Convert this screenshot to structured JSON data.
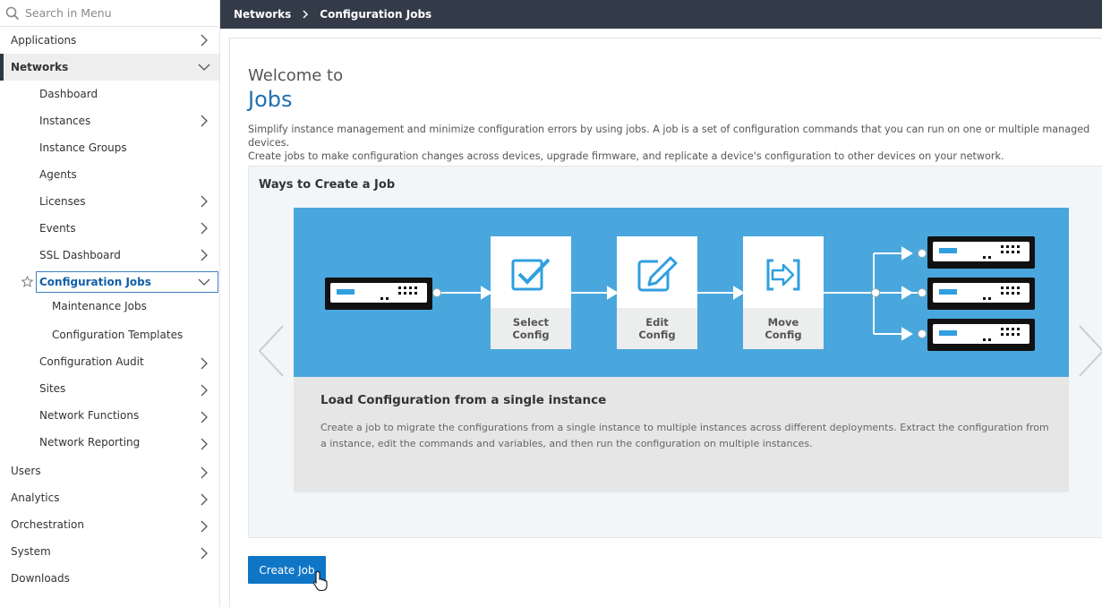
{
  "search": {
    "placeholder": "Search in Menu"
  },
  "sidebar": {
    "applications": "Applications",
    "networks": "Networks",
    "dashboard": "Dashboard",
    "instances": "Instances",
    "instance_groups": "Instance Groups",
    "agents": "Agents",
    "licenses": "Licenses",
    "events": "Events",
    "ssl_dashboard": "SSL Dashboard",
    "configuration_jobs": "Configuration Jobs",
    "maintenance_jobs": "Maintenance Jobs",
    "configuration_templates": "Configuration Templates",
    "configuration_audit": "Configuration Audit",
    "sites": "Sites",
    "network_functions": "Network Functions",
    "network_reporting": "Network Reporting",
    "users": "Users",
    "analytics": "Analytics",
    "orchestration": "Orchestration",
    "system": "System",
    "downloads": "Downloads"
  },
  "breadcrumb": {
    "root": "Networks",
    "current": "Configuration Jobs"
  },
  "main": {
    "welcome": "Welcome to",
    "title": "Jobs",
    "description_line1": "Simplify instance management and minimize configuration errors by using jobs. A job is a set of configuration commands that you can run on one or multiple managed devices.",
    "description_line2": "Create jobs to make configuration changes across devices, upgrade firmware, and replicate a device's configuration to other devices on your network.",
    "ways_title": "Ways to Create a Job",
    "steps": [
      {
        "line1": "Select",
        "line2": "Config"
      },
      {
        "line1": "Edit",
        "line2": "Config"
      },
      {
        "line1": "Move",
        "line2": "Config"
      }
    ],
    "caption_title": "Load Configuration from a single instance",
    "caption_text": "Create a job to migrate the configurations from a single instance to multiple instances across different deployments. Extract the configuration from a instance, edit the commands and variables, and then run the configuration on multiple instances.",
    "create_button": "Create Job"
  },
  "colors": {
    "topbar": "#343b48",
    "accent_blue": "#1f6fb2",
    "diagram_blue": "#49a7de",
    "icon_blue": "#2f9fe0",
    "button_blue": "#0f76c6"
  },
  "icons": {
    "search": "search-icon",
    "chevron": "chevron-right-icon",
    "chevron_open": "chevron-down-icon",
    "favorite": "star-icon",
    "breadcrumb_sep": "chevron-right-icon",
    "select_config": "checkbox-check-icon",
    "edit_config": "edit-pencil-icon",
    "move_config": "move-arrow-icon",
    "appliance": "server-appliance-icon",
    "carousel_prev": "chevron-left-icon",
    "carousel_next": "chevron-right-icon"
  }
}
